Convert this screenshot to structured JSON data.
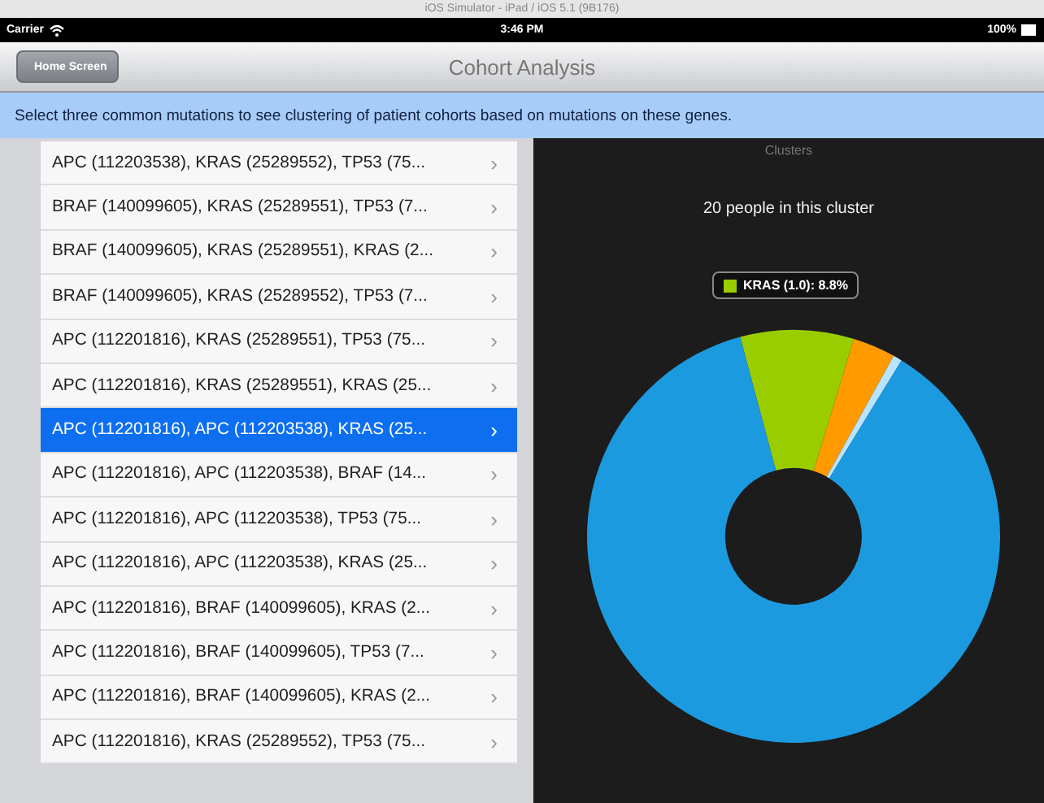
{
  "window": {
    "title": "iOS Simulator - iPad / iOS 5.1 (9B176)"
  },
  "status_bar": {
    "carrier": "Carrier",
    "time": "3:46 PM",
    "battery": "100%"
  },
  "nav_bar": {
    "back_button": "Home Screen",
    "title": "Cohort Analysis"
  },
  "banner": "Select three common mutations to see clustering of patient cohorts based on mutations on these genes.",
  "list": [
    {
      "label": "APC (112203538), KRAS (25289552), TP53 (75...",
      "chevron": "›",
      "selected": false
    },
    {
      "label": "BRAF (140099605), KRAS (25289551), TP53 (7...",
      "chevron": "›",
      "selected": false
    },
    {
      "label": "BRAF (140099605), KRAS (25289551), KRAS (2...",
      "chevron": "›",
      "selected": false
    },
    {
      "label": "BRAF (140099605), KRAS (25289552), TP53 (7...",
      "chevron": "›",
      "selected": false
    },
    {
      "label": "APC (112201816), KRAS (25289551), TP53 (75...",
      "chevron": "›",
      "selected": false
    },
    {
      "label": "APC (112201816), KRAS (25289551), KRAS (25...",
      "chevron": "›",
      "selected": false
    },
    {
      "label": "APC (112201816), APC (112203538), KRAS (25...",
      "chevron": "›",
      "selected": true
    },
    {
      "label": "APC (112201816), APC (112203538), BRAF (14...",
      "chevron": "›",
      "selected": false
    },
    {
      "label": "APC (112201816), APC (112203538), TP53 (75...",
      "chevron": "›",
      "selected": false
    },
    {
      "label": "APC (112201816), APC (112203538), KRAS (25...",
      "chevron": "›",
      "selected": false
    },
    {
      "label": "APC (112201816), BRAF (140099605), KRAS (2...",
      "chevron": "›",
      "selected": false
    },
    {
      "label": "APC (112201816), BRAF (140099605), TP53 (7...",
      "chevron": "›",
      "selected": false
    },
    {
      "label": "APC (112201816), BRAF (140099605), KRAS (2...",
      "chevron": "›",
      "selected": false
    },
    {
      "label": "APC (112201816), KRAS (25289552), TP53 (75...",
      "chevron": "›",
      "selected": false
    }
  ],
  "detail": {
    "title": "Clusters",
    "caption": "20 people in this cluster",
    "tooltip": {
      "label": "KRAS (1.0): 8.8%",
      "color": "#9acd00"
    }
  }
}
